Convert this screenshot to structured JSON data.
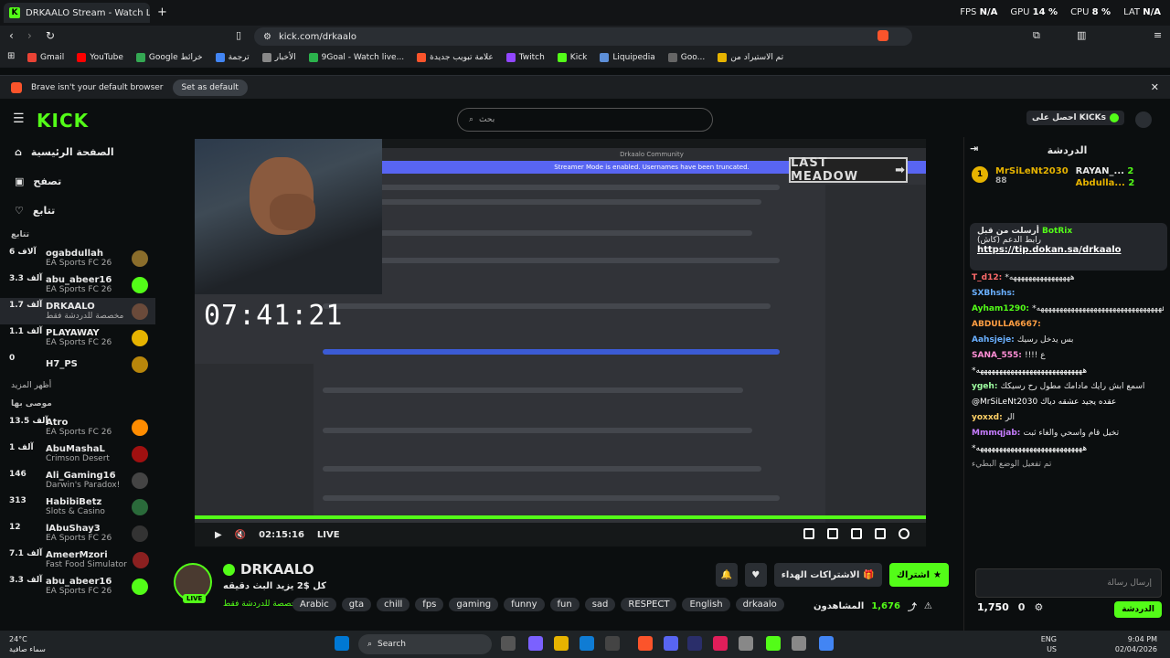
{
  "browser": {
    "tab_title": "DRKAALO Stream - Watch Live o",
    "stats": [
      {
        "label": "FPS",
        "value": "N/A"
      },
      {
        "label": "GPU",
        "value": "14 %"
      },
      {
        "label": "CPU",
        "value": "8 %"
      },
      {
        "label": "LAT",
        "value": "N/A"
      }
    ],
    "url": "kick.com/drkaalo",
    "bookmarks": [
      "Gmail",
      "YouTube",
      "Google خرائط",
      "ترجمة",
      "الأخبار",
      "9Goal - Watch live...",
      "علامة تبويب جديدة",
      "Twitch",
      "Kick",
      "Liquipedia",
      "Goo...",
      "تم الاستيراد من"
    ],
    "notice": "Brave isn't your default browser",
    "set_default": "Set as default"
  },
  "header": {
    "search_placeholder": "بحث",
    "kicks_label": "احصل على KICKs",
    "logo": "KICK"
  },
  "sidebar": {
    "nav": [
      {
        "label": "الصفحة الرئيسية"
      },
      {
        "label": "تصفح"
      },
      {
        "label": "تتابع"
      }
    ],
    "following_title": "تتابع",
    "following": [
      {
        "name": "ogabdullah",
        "viewers": "6 آلاف",
        "game": "EA Sports FC 26",
        "color": "#8a6d2b"
      },
      {
        "name": "abu_abeer16",
        "viewers": "3.3 آلف",
        "game": "EA Sports FC 26",
        "color": "#53fc18"
      },
      {
        "name": "DRKAALO",
        "viewers": "1.7 آلف",
        "game": "مخصصة للدردشة فقط",
        "color": "#6a4a3a"
      },
      {
        "name": "PLAYAWAY",
        "viewers": "1.1 آلف",
        "game": "EA Sports FC 26",
        "color": "#e6b300"
      },
      {
        "name": "H7_PS",
        "viewers": "0",
        "game": "",
        "color": "#b8860b"
      }
    ],
    "show_more": "أظهر المزيد",
    "recommended_title": "موصى بها",
    "recommended": [
      {
        "name": "Atro",
        "viewers": "13.5 آلف",
        "game": "EA Sports FC 26",
        "color": "#ff8c00"
      },
      {
        "name": "AbuMashaL",
        "viewers": "1 آلف",
        "game": "Crimson Desert",
        "color": "#a01010"
      },
      {
        "name": "Ali_Gaming16",
        "viewers": "146",
        "game": "Darwin's Paradox!",
        "color": "#444"
      },
      {
        "name": "HabibiBetz",
        "viewers": "313",
        "game": "Slots & Casino",
        "color": "#2a6a3a"
      },
      {
        "name": "lAbuShay3",
        "viewers": "12",
        "game": "EA Sports FC 26",
        "color": "#333"
      },
      {
        "name": "AmeerMzori",
        "viewers": "7.1 آلف",
        "game": "Fast Food Simulator",
        "color": "#8b2020"
      },
      {
        "name": "abu_abeer16",
        "viewers": "3.3 آلف",
        "game": "EA Sports FC 26",
        "color": "#53fc18"
      }
    ]
  },
  "player": {
    "timer": "07:41:21",
    "time": "02:15:16",
    "live": "LIVE",
    "last_meadow": "LAST MEADOW",
    "discord_server": "Drkaalo Community",
    "discord_banner": "Streamer Mode is enabled. Usernames have been truncated.",
    "progress_pct": 100
  },
  "stream": {
    "name": "DRKAALO",
    "title": "كل $2 يزيد البث دقيقه",
    "category": "مخصصة للدردشة فقط",
    "live_badge": "LIVE",
    "tags": [
      "Arabic",
      "gta",
      "chill",
      "fps",
      "gaming",
      "funny",
      "fun",
      "sad",
      "RESPECT",
      "English",
      "drkaalo"
    ],
    "subscribe": "اشتراك",
    "gift": "الاشتراكات الهداء",
    "viewers": "1,676",
    "viewers_label": "المشاهدون"
  },
  "chat": {
    "title": "الدردشة",
    "leaderboard": [
      {
        "name": "MrSiLeNt2030",
        "count": "88",
        "rank": "1"
      },
      {
        "name": "RAYAN_...",
        "count": "2"
      },
      {
        "name": "Abdulla...",
        "count": "2"
      }
    ],
    "pinned_by": "أرسلت من قبل",
    "pinned_user": "BotRix",
    "pinned_text": "رابط الدعم (كاش)",
    "pinned_link": "https://tip.dokan.sa/drkaalo",
    "messages": [
      {
        "user": "T_d12",
        "color": "#ff6b6b",
        "text": "*ههههههههههههههههه"
      },
      {
        "user": "SXBhshs",
        "color": "#6ab0ff",
        "text": ""
      },
      {
        "user": "Ayham1290",
        "color": "#53fc18",
        "text": "*هههههههههههههههههههههههههههههههههه"
      },
      {
        "user": "ABDULLA6667",
        "color": "#ff9f43",
        "text": ""
      },
      {
        "user": "Aahsjeje",
        "color": "#6ab0ff",
        "text": "بس يدخل رسيك"
      },
      {
        "user": "SANA_555",
        "color": "#ff8fd6",
        "text": "!!!! ع"
      },
      {
        "user": "",
        "color": "#fff",
        "text": "*ههههههههههههههههههههههههههههه"
      },
      {
        "user": "ygeh",
        "color": "#9effa1",
        "text": "اسمع ابش رايك مادامك مطول رح رسيكك"
      },
      {
        "user": "",
        "color": "#fff",
        "text": "@MrSiLeNt2030 عقده يجيد عشقه دياك"
      },
      {
        "user": "yoxxd",
        "color": "#ffd166",
        "text": "الر"
      },
      {
        "user": "Mmmqjab",
        "color": "#c77dff",
        "text": "تخيل قام واسحي والغاء ثبت"
      },
      {
        "user": "",
        "color": "#fff",
        "text": "*ههههههههههههههههههههههههههههه"
      },
      {
        "user": "",
        "color": "#aaa",
        "text": "تم تفعيل الوضع البطيء"
      }
    ],
    "input_placeholder": "إرسال رسالة",
    "points": "1,750",
    "kicks": "0",
    "chat_button": "الدردشة"
  },
  "taskbar": {
    "temp": "24°C",
    "weather": "سماء صافية",
    "search": "Search",
    "lang": "ENG",
    "region": "US",
    "time": "9:04 PM",
    "date": "02/04/2026"
  }
}
